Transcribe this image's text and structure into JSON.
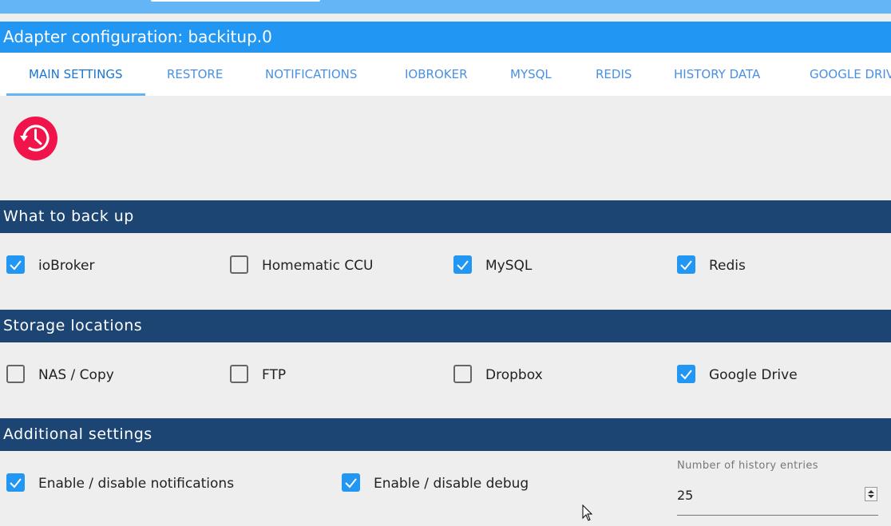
{
  "window": {
    "title": "Adapter configuration: backitup.0"
  },
  "tabs": [
    {
      "label": "MAIN SETTINGS",
      "active": true
    },
    {
      "label": "RESTORE"
    },
    {
      "label": "NOTIFICATIONS"
    },
    {
      "label": "IOBROKER"
    },
    {
      "label": "MYSQL"
    },
    {
      "label": "REDIS"
    },
    {
      "label": "HISTORY DATA"
    },
    {
      "label": "GOOGLE DRIVE"
    }
  ],
  "logo": {
    "icon": "backup-restore-clock-icon",
    "color": "#f0144b"
  },
  "sections": {
    "backup": {
      "title": "What to back up",
      "items": [
        {
          "label": "ioBroker",
          "checked": true
        },
        {
          "label": "Homematic CCU",
          "checked": false
        },
        {
          "label": "MySQL",
          "checked": true
        },
        {
          "label": "Redis",
          "checked": true
        }
      ]
    },
    "storage": {
      "title": "Storage locations",
      "items": [
        {
          "label": "NAS / Copy",
          "checked": false
        },
        {
          "label": "FTP",
          "checked": false
        },
        {
          "label": "Dropbox",
          "checked": false
        },
        {
          "label": "Google Drive",
          "checked": true
        }
      ]
    },
    "additional": {
      "title": "Additional settings",
      "items": [
        {
          "label": "Enable / disable notifications",
          "checked": true
        },
        {
          "label": "Enable / disable debug",
          "checked": true
        }
      ],
      "history_entries": {
        "label": "Number of history entries",
        "value": "25"
      }
    }
  },
  "colors": {
    "title_bar": "#2196f3",
    "section_header": "#1c4573",
    "checkbox_checked": "#2196f3",
    "tab_text": "#4a90e2"
  }
}
